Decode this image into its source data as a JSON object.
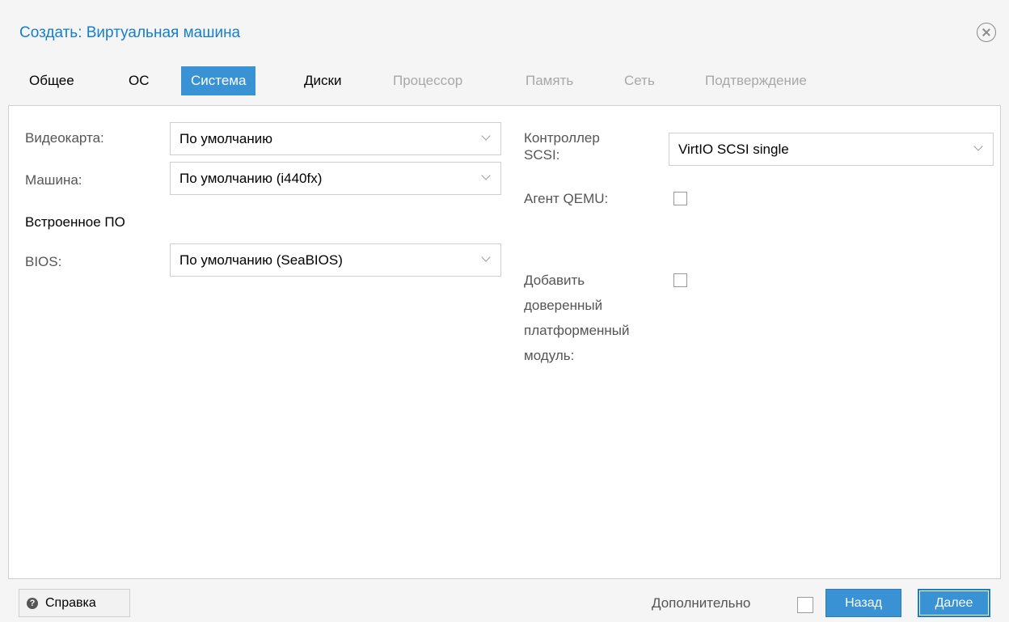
{
  "dialog": {
    "title": "Создать: Виртуальная машина",
    "close_icon": "close-circle-icon"
  },
  "tabs": [
    {
      "label": "Общее",
      "state": "enabled"
    },
    {
      "label": "ОС",
      "state": "enabled"
    },
    {
      "label": "Система",
      "state": "active"
    },
    {
      "label": "Диски",
      "state": "enabled"
    },
    {
      "label": "Процессор",
      "state": "disabled"
    },
    {
      "label": "Память",
      "state": "disabled"
    },
    {
      "label": "Сеть",
      "state": "disabled"
    },
    {
      "label": "Подтверждение",
      "state": "disabled"
    }
  ],
  "left": {
    "videocard": {
      "label": "Видеокарта:",
      "value": "По умолчанию"
    },
    "machine": {
      "label": "Машина:",
      "value": "По умолчанию (i440fx)"
    },
    "firmware_heading": "Встроенное ПО",
    "bios": {
      "label": "BIOS:",
      "value": "По умолчанию (SeaBIOS)"
    }
  },
  "right": {
    "scsi": {
      "label_line1": "Контроллер",
      "label_line2": "SCSI:",
      "value": "VirtIO SCSI single"
    },
    "qemu_agent": {
      "label": "Агент QEMU:",
      "checked": false
    },
    "tpm": {
      "label_line1": "Добавить",
      "label_line2": "доверенный",
      "label_line3": "платформенный",
      "label_line4": "модуль:",
      "checked": false
    }
  },
  "footer": {
    "help_label": "Справка",
    "help_icon": "question-circle-icon",
    "advanced_label": "Дополнительно",
    "advanced_checked": false,
    "back_label": "Назад",
    "next_label": "Далее"
  },
  "colors": {
    "accent": "#3892d4",
    "title": "#157fcc",
    "disabled_text": "#a8a8a8"
  }
}
